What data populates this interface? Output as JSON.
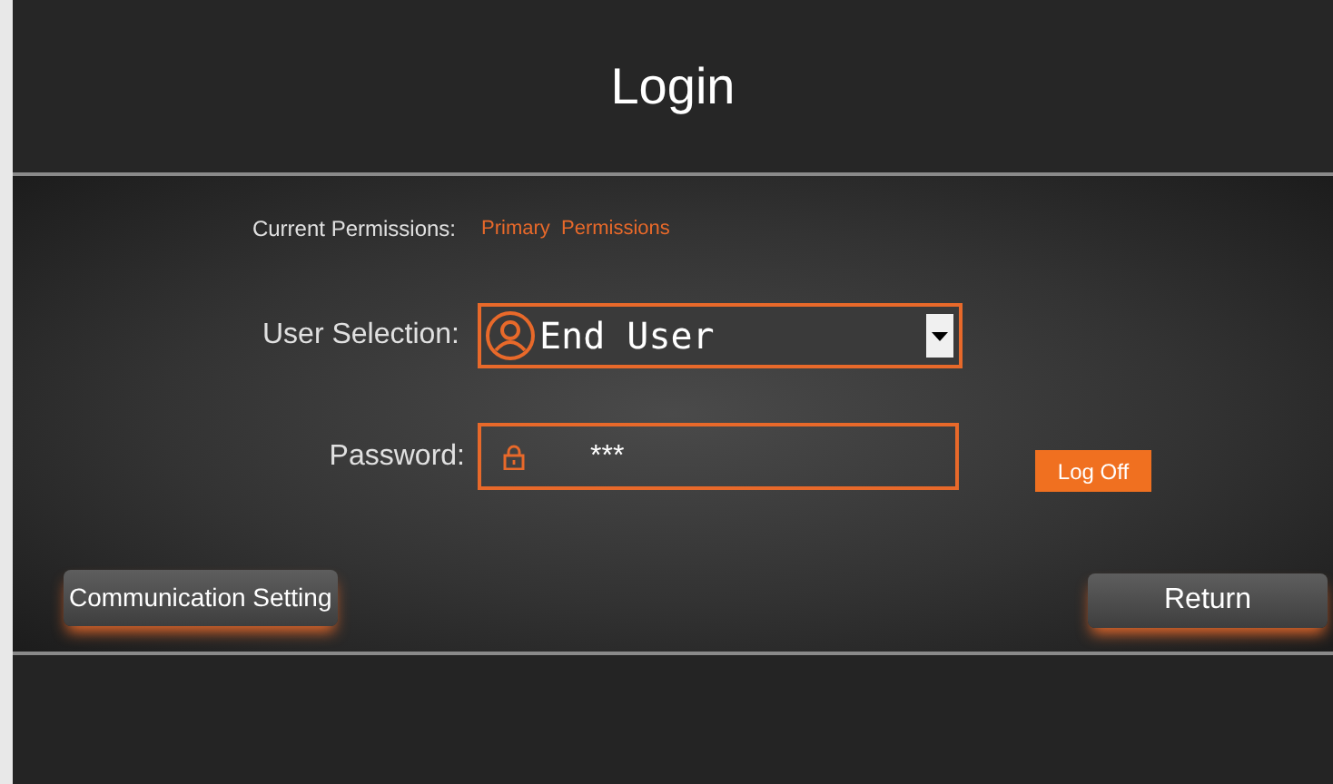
{
  "title": "Login",
  "permissions": {
    "label": "Current Permissions:",
    "value": "Primary  Permissions"
  },
  "user_selection": {
    "label": "User Selection:",
    "value": "End User"
  },
  "password": {
    "label": "Password:",
    "value": "***"
  },
  "log_off_button": "Log Off",
  "buttons": [
    "Communication Setting",
    "Return"
  ]
}
